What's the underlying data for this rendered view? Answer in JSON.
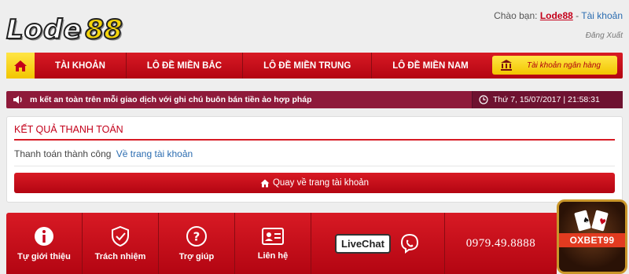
{
  "header": {
    "logo_word": "Lode",
    "logo_number": "88",
    "greeting": "Chào bạn:",
    "username": "Lode88",
    "separator": "-",
    "account_link": "Tài khoản",
    "logout": "Đăng Xuất"
  },
  "nav": {
    "items": [
      "TÀI KHOẢN",
      "LÔ ĐỀ MIỀN BẮC",
      "LÔ ĐỀ MIỀN TRUNG",
      "LÔ ĐỀ MIỀN NAM"
    ],
    "bank_label": "Tài khoản ngân hàng"
  },
  "ticker": {
    "text": "m kết an toàn trên mỗi giao dịch với ghi chú buôn bán tiền ảo hợp pháp",
    "datetime": "Thứ 7, 15/07/2017 | 21:58:31"
  },
  "panel": {
    "title": "KẾT QUẢ THANH TOÁN",
    "message": "Thanh toán thành công",
    "message_link": "Về trang tài khoản",
    "back_button": "Quay về trang tài khoản"
  },
  "footer": {
    "items": [
      "Tự giới thiệu",
      "Trách nhiệm",
      "Trợ giúp",
      "Liên hệ"
    ],
    "livechat": "LiveChat",
    "phone": "0979.49.8888"
  },
  "ad": {
    "text": "OXBET99"
  },
  "colors": {
    "primary_red": "#c4001a",
    "nav_red": "#d81a24",
    "accent_yellow": "#f2c600",
    "ticker_bg": "#8e1a3a",
    "link_blue": "#2b6cb0"
  }
}
